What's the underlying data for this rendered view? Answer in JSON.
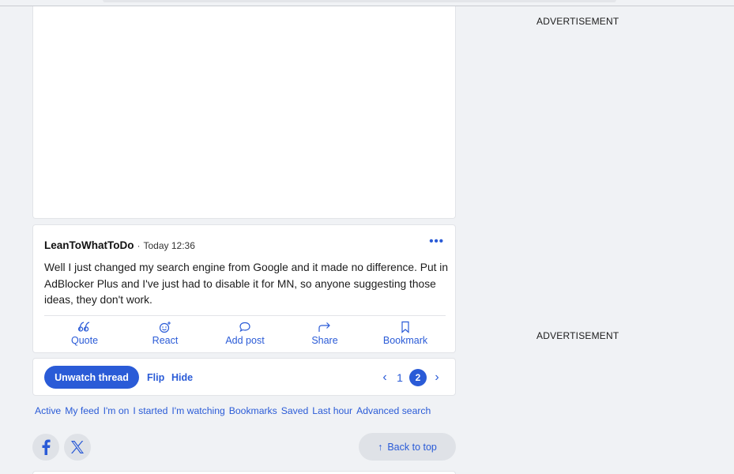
{
  "post": {
    "author": "LeanToWhatToDo",
    "separator": "·",
    "time": "Today 12:36",
    "more": "•••",
    "body": "Well I just changed my search engine from Google and it made no difference. Put in AdBlocker Plus and I've just had to disable it for MN, so anyone suggesting those ideas, they don't work.",
    "actions": [
      {
        "label": "Quote",
        "icon": "quote-icon"
      },
      {
        "label": "React",
        "icon": "react-icon"
      },
      {
        "label": "Add post",
        "icon": "comment-icon"
      },
      {
        "label": "Share",
        "icon": "share-icon"
      },
      {
        "label": "Bookmark",
        "icon": "bookmark-icon"
      }
    ]
  },
  "thread_nav": {
    "unwatch_label": "Unwatch thread",
    "flip_label": "Flip",
    "hide_label": "Hide",
    "pages": [
      "1",
      "2"
    ],
    "current_page": "2"
  },
  "quick_links": [
    "Active",
    "My feed",
    "I'm on",
    "I started",
    "I'm watching",
    "Bookmarks",
    "Saved",
    "Last hour",
    "Advanced search"
  ],
  "footer": {
    "back_to_top_label": "Back to top",
    "back_to_top_arrow": "↑",
    "social": [
      {
        "name": "facebook-icon",
        "glyph": "f"
      },
      {
        "name": "x-twitter-icon",
        "glyph": "𝕏"
      }
    ]
  },
  "sidebar": {
    "ad_label_1": "ADVERTISEMENT",
    "ad_label_2": "ADVERTISEMENT"
  },
  "colors": {
    "accent": "#2a5bd7",
    "background": "#f0f2f5",
    "card": "#ffffff"
  }
}
